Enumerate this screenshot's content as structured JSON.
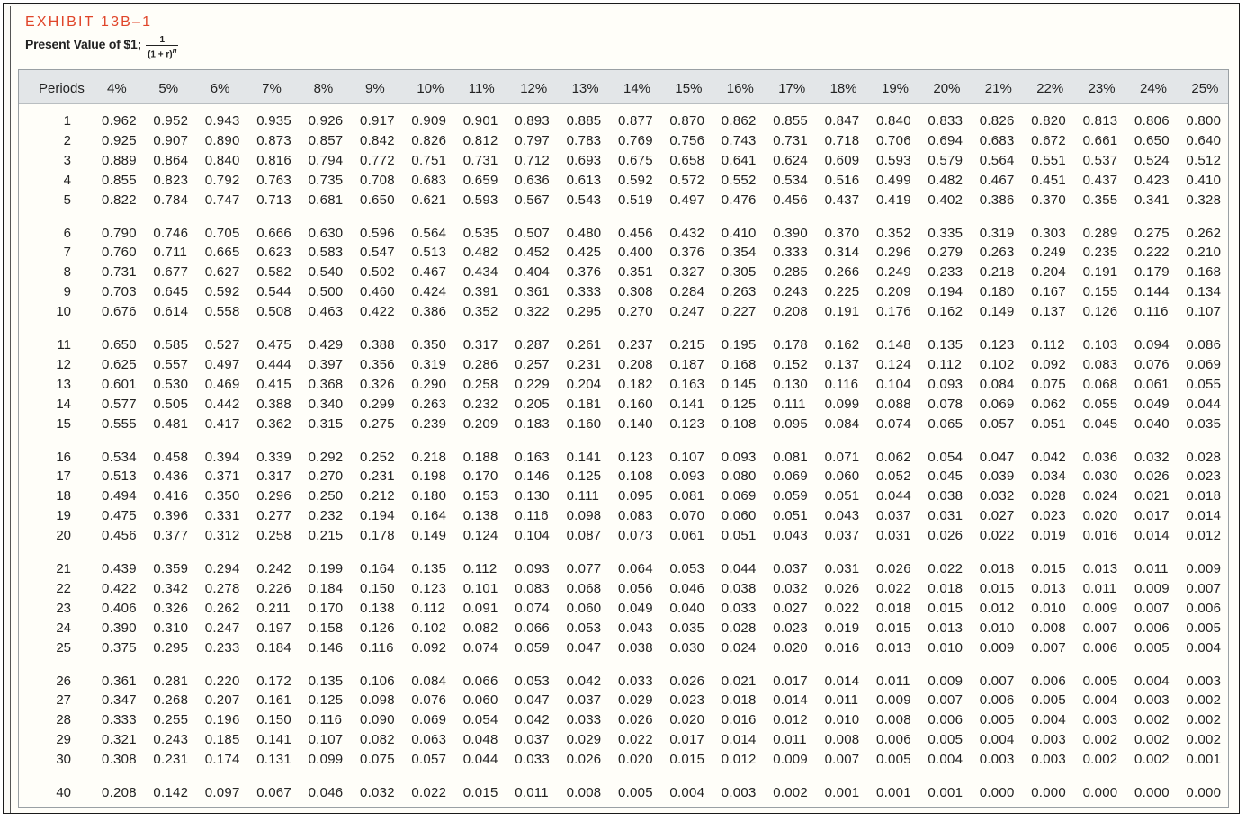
{
  "header": {
    "exhibit_label": "EXHIBIT 13B–1",
    "subtitle": "Present Value of $1;",
    "formula_numerator": "1",
    "formula_denominator": "(1 + r)",
    "formula_exponent": "n"
  },
  "table": {
    "periods_label": "Periods",
    "rates": [
      "4%",
      "5%",
      "6%",
      "7%",
      "8%",
      "9%",
      "10%",
      "11%",
      "12%",
      "13%",
      "14%",
      "15%",
      "16%",
      "17%",
      "18%",
      "19%",
      "20%",
      "21%",
      "22%",
      "23%",
      "24%",
      "25%"
    ],
    "rows": [
      {
        "period": "1",
        "values": [
          "0.962",
          "0.952",
          "0.943",
          "0.935",
          "0.926",
          "0.917",
          "0.909",
          "0.901",
          "0.893",
          "0.885",
          "0.877",
          "0.870",
          "0.862",
          "0.855",
          "0.847",
          "0.840",
          "0.833",
          "0.826",
          "0.820",
          "0.813",
          "0.806",
          "0.800"
        ]
      },
      {
        "period": "2",
        "values": [
          "0.925",
          "0.907",
          "0.890",
          "0.873",
          "0.857",
          "0.842",
          "0.826",
          "0.812",
          "0.797",
          "0.783",
          "0.769",
          "0.756",
          "0.743",
          "0.731",
          "0.718",
          "0.706",
          "0.694",
          "0.683",
          "0.672",
          "0.661",
          "0.650",
          "0.640"
        ]
      },
      {
        "period": "3",
        "values": [
          "0.889",
          "0.864",
          "0.840",
          "0.816",
          "0.794",
          "0.772",
          "0.751",
          "0.731",
          "0.712",
          "0.693",
          "0.675",
          "0.658",
          "0.641",
          "0.624",
          "0.609",
          "0.593",
          "0.579",
          "0.564",
          "0.551",
          "0.537",
          "0.524",
          "0.512"
        ]
      },
      {
        "period": "4",
        "values": [
          "0.855",
          "0.823",
          "0.792",
          "0.763",
          "0.735",
          "0.708",
          "0.683",
          "0.659",
          "0.636",
          "0.613",
          "0.592",
          "0.572",
          "0.552",
          "0.534",
          "0.516",
          "0.499",
          "0.482",
          "0.467",
          "0.451",
          "0.437",
          "0.423",
          "0.410"
        ]
      },
      {
        "period": "5",
        "values": [
          "0.822",
          "0.784",
          "0.747",
          "0.713",
          "0.681",
          "0.650",
          "0.621",
          "0.593",
          "0.567",
          "0.543",
          "0.519",
          "0.497",
          "0.476",
          "0.456",
          "0.437",
          "0.419",
          "0.402",
          "0.386",
          "0.370",
          "0.355",
          "0.341",
          "0.328"
        ]
      },
      {
        "period": "6",
        "values": [
          "0.790",
          "0.746",
          "0.705",
          "0.666",
          "0.630",
          "0.596",
          "0.564",
          "0.535",
          "0.507",
          "0.480",
          "0.456",
          "0.432",
          "0.410",
          "0.390",
          "0.370",
          "0.352",
          "0.335",
          "0.319",
          "0.303",
          "0.289",
          "0.275",
          "0.262"
        ]
      },
      {
        "period": "7",
        "values": [
          "0.760",
          "0.711",
          "0.665",
          "0.623",
          "0.583",
          "0.547",
          "0.513",
          "0.482",
          "0.452",
          "0.425",
          "0.400",
          "0.376",
          "0.354",
          "0.333",
          "0.314",
          "0.296",
          "0.279",
          "0.263",
          "0.249",
          "0.235",
          "0.222",
          "0.210"
        ]
      },
      {
        "period": "8",
        "values": [
          "0.731",
          "0.677",
          "0.627",
          "0.582",
          "0.540",
          "0.502",
          "0.467",
          "0.434",
          "0.404",
          "0.376",
          "0.351",
          "0.327",
          "0.305",
          "0.285",
          "0.266",
          "0.249",
          "0.233",
          "0.218",
          "0.204",
          "0.191",
          "0.179",
          "0.168"
        ]
      },
      {
        "period": "9",
        "values": [
          "0.703",
          "0.645",
          "0.592",
          "0.544",
          "0.500",
          "0.460",
          "0.424",
          "0.391",
          "0.361",
          "0.333",
          "0.308",
          "0.284",
          "0.263",
          "0.243",
          "0.225",
          "0.209",
          "0.194",
          "0.180",
          "0.167",
          "0.155",
          "0.144",
          "0.134"
        ]
      },
      {
        "period": "10",
        "values": [
          "0.676",
          "0.614",
          "0.558",
          "0.508",
          "0.463",
          "0.422",
          "0.386",
          "0.352",
          "0.322",
          "0.295",
          "0.270",
          "0.247",
          "0.227",
          "0.208",
          "0.191",
          "0.176",
          "0.162",
          "0.149",
          "0.137",
          "0.126",
          "0.116",
          "0.107"
        ]
      },
      {
        "period": "11",
        "values": [
          "0.650",
          "0.585",
          "0.527",
          "0.475",
          "0.429",
          "0.388",
          "0.350",
          "0.317",
          "0.287",
          "0.261",
          "0.237",
          "0.215",
          "0.195",
          "0.178",
          "0.162",
          "0.148",
          "0.135",
          "0.123",
          "0.112",
          "0.103",
          "0.094",
          "0.086"
        ]
      },
      {
        "period": "12",
        "values": [
          "0.625",
          "0.557",
          "0.497",
          "0.444",
          "0.397",
          "0.356",
          "0.319",
          "0.286",
          "0.257",
          "0.231",
          "0.208",
          "0.187",
          "0.168",
          "0.152",
          "0.137",
          "0.124",
          "0.112",
          "0.102",
          "0.092",
          "0.083",
          "0.076",
          "0.069"
        ]
      },
      {
        "period": "13",
        "values": [
          "0.601",
          "0.530",
          "0.469",
          "0.415",
          "0.368",
          "0.326",
          "0.290",
          "0.258",
          "0.229",
          "0.204",
          "0.182",
          "0.163",
          "0.145",
          "0.130",
          "0.116",
          "0.104",
          "0.093",
          "0.084",
          "0.075",
          "0.068",
          "0.061",
          "0.055"
        ]
      },
      {
        "period": "14",
        "values": [
          "0.577",
          "0.505",
          "0.442",
          "0.388",
          "0.340",
          "0.299",
          "0.263",
          "0.232",
          "0.205",
          "0.181",
          "0.160",
          "0.141",
          "0.125",
          "0.111",
          "0.099",
          "0.088",
          "0.078",
          "0.069",
          "0.062",
          "0.055",
          "0.049",
          "0.044"
        ]
      },
      {
        "period": "15",
        "values": [
          "0.555",
          "0.481",
          "0.417",
          "0.362",
          "0.315",
          "0.275",
          "0.239",
          "0.209",
          "0.183",
          "0.160",
          "0.140",
          "0.123",
          "0.108",
          "0.095",
          "0.084",
          "0.074",
          "0.065",
          "0.057",
          "0.051",
          "0.045",
          "0.040",
          "0.035"
        ]
      },
      {
        "period": "16",
        "values": [
          "0.534",
          "0.458",
          "0.394",
          "0.339",
          "0.292",
          "0.252",
          "0.218",
          "0.188",
          "0.163",
          "0.141",
          "0.123",
          "0.107",
          "0.093",
          "0.081",
          "0.071",
          "0.062",
          "0.054",
          "0.047",
          "0.042",
          "0.036",
          "0.032",
          "0.028"
        ]
      },
      {
        "period": "17",
        "values": [
          "0.513",
          "0.436",
          "0.371",
          "0.317",
          "0.270",
          "0.231",
          "0.198",
          "0.170",
          "0.146",
          "0.125",
          "0.108",
          "0.093",
          "0.080",
          "0.069",
          "0.060",
          "0.052",
          "0.045",
          "0.039",
          "0.034",
          "0.030",
          "0.026",
          "0.023"
        ]
      },
      {
        "period": "18",
        "values": [
          "0.494",
          "0.416",
          "0.350",
          "0.296",
          "0.250",
          "0.212",
          "0.180",
          "0.153",
          "0.130",
          "0.111",
          "0.095",
          "0.081",
          "0.069",
          "0.059",
          "0.051",
          "0.044",
          "0.038",
          "0.032",
          "0.028",
          "0.024",
          "0.021",
          "0.018"
        ]
      },
      {
        "period": "19",
        "values": [
          "0.475",
          "0.396",
          "0.331",
          "0.277",
          "0.232",
          "0.194",
          "0.164",
          "0.138",
          "0.116",
          "0.098",
          "0.083",
          "0.070",
          "0.060",
          "0.051",
          "0.043",
          "0.037",
          "0.031",
          "0.027",
          "0.023",
          "0.020",
          "0.017",
          "0.014"
        ]
      },
      {
        "period": "20",
        "values": [
          "0.456",
          "0.377",
          "0.312",
          "0.258",
          "0.215",
          "0.178",
          "0.149",
          "0.124",
          "0.104",
          "0.087",
          "0.073",
          "0.061",
          "0.051",
          "0.043",
          "0.037",
          "0.031",
          "0.026",
          "0.022",
          "0.019",
          "0.016",
          "0.014",
          "0.012"
        ]
      },
      {
        "period": "21",
        "values": [
          "0.439",
          "0.359",
          "0.294",
          "0.242",
          "0.199",
          "0.164",
          "0.135",
          "0.112",
          "0.093",
          "0.077",
          "0.064",
          "0.053",
          "0.044",
          "0.037",
          "0.031",
          "0.026",
          "0.022",
          "0.018",
          "0.015",
          "0.013",
          "0.011",
          "0.009"
        ]
      },
      {
        "period": "22",
        "values": [
          "0.422",
          "0.342",
          "0.278",
          "0.226",
          "0.184",
          "0.150",
          "0.123",
          "0.101",
          "0.083",
          "0.068",
          "0.056",
          "0.046",
          "0.038",
          "0.032",
          "0.026",
          "0.022",
          "0.018",
          "0.015",
          "0.013",
          "0.011",
          "0.009",
          "0.007"
        ]
      },
      {
        "period": "23",
        "values": [
          "0.406",
          "0.326",
          "0.262",
          "0.211",
          "0.170",
          "0.138",
          "0.112",
          "0.091",
          "0.074",
          "0.060",
          "0.049",
          "0.040",
          "0.033",
          "0.027",
          "0.022",
          "0.018",
          "0.015",
          "0.012",
          "0.010",
          "0.009",
          "0.007",
          "0.006"
        ]
      },
      {
        "period": "24",
        "values": [
          "0.390",
          "0.310",
          "0.247",
          "0.197",
          "0.158",
          "0.126",
          "0.102",
          "0.082",
          "0.066",
          "0.053",
          "0.043",
          "0.035",
          "0.028",
          "0.023",
          "0.019",
          "0.015",
          "0.013",
          "0.010",
          "0.008",
          "0.007",
          "0.006",
          "0.005"
        ]
      },
      {
        "period": "25",
        "values": [
          "0.375",
          "0.295",
          "0.233",
          "0.184",
          "0.146",
          "0.116",
          "0.092",
          "0.074",
          "0.059",
          "0.047",
          "0.038",
          "0.030",
          "0.024",
          "0.020",
          "0.016",
          "0.013",
          "0.010",
          "0.009",
          "0.007",
          "0.006",
          "0.005",
          "0.004"
        ]
      },
      {
        "period": "26",
        "values": [
          "0.361",
          "0.281",
          "0.220",
          "0.172",
          "0.135",
          "0.106",
          "0.084",
          "0.066",
          "0.053",
          "0.042",
          "0.033",
          "0.026",
          "0.021",
          "0.017",
          "0.014",
          "0.011",
          "0.009",
          "0.007",
          "0.006",
          "0.005",
          "0.004",
          "0.003"
        ]
      },
      {
        "period": "27",
        "values": [
          "0.347",
          "0.268",
          "0.207",
          "0.161",
          "0.125",
          "0.098",
          "0.076",
          "0.060",
          "0.047",
          "0.037",
          "0.029",
          "0.023",
          "0.018",
          "0.014",
          "0.011",
          "0.009",
          "0.007",
          "0.006",
          "0.005",
          "0.004",
          "0.003",
          "0.002"
        ]
      },
      {
        "period": "28",
        "values": [
          "0.333",
          "0.255",
          "0.196",
          "0.150",
          "0.116",
          "0.090",
          "0.069",
          "0.054",
          "0.042",
          "0.033",
          "0.026",
          "0.020",
          "0.016",
          "0.012",
          "0.010",
          "0.008",
          "0.006",
          "0.005",
          "0.004",
          "0.003",
          "0.002",
          "0.002"
        ]
      },
      {
        "period": "29",
        "values": [
          "0.321",
          "0.243",
          "0.185",
          "0.141",
          "0.107",
          "0.082",
          "0.063",
          "0.048",
          "0.037",
          "0.029",
          "0.022",
          "0.017",
          "0.014",
          "0.011",
          "0.008",
          "0.006",
          "0.005",
          "0.004",
          "0.003",
          "0.002",
          "0.002",
          "0.002"
        ]
      },
      {
        "period": "30",
        "values": [
          "0.308",
          "0.231",
          "0.174",
          "0.131",
          "0.099",
          "0.075",
          "0.057",
          "0.044",
          "0.033",
          "0.026",
          "0.020",
          "0.015",
          "0.012",
          "0.009",
          "0.007",
          "0.005",
          "0.004",
          "0.003",
          "0.003",
          "0.002",
          "0.002",
          "0.001"
        ]
      },
      {
        "period": "40",
        "values": [
          "0.208",
          "0.142",
          "0.097",
          "0.067",
          "0.046",
          "0.032",
          "0.022",
          "0.015",
          "0.011",
          "0.008",
          "0.005",
          "0.004",
          "0.003",
          "0.002",
          "0.001",
          "0.001",
          "0.001",
          "0.000",
          "0.000",
          "0.000",
          "0.000",
          "0.000"
        ]
      }
    ]
  }
}
